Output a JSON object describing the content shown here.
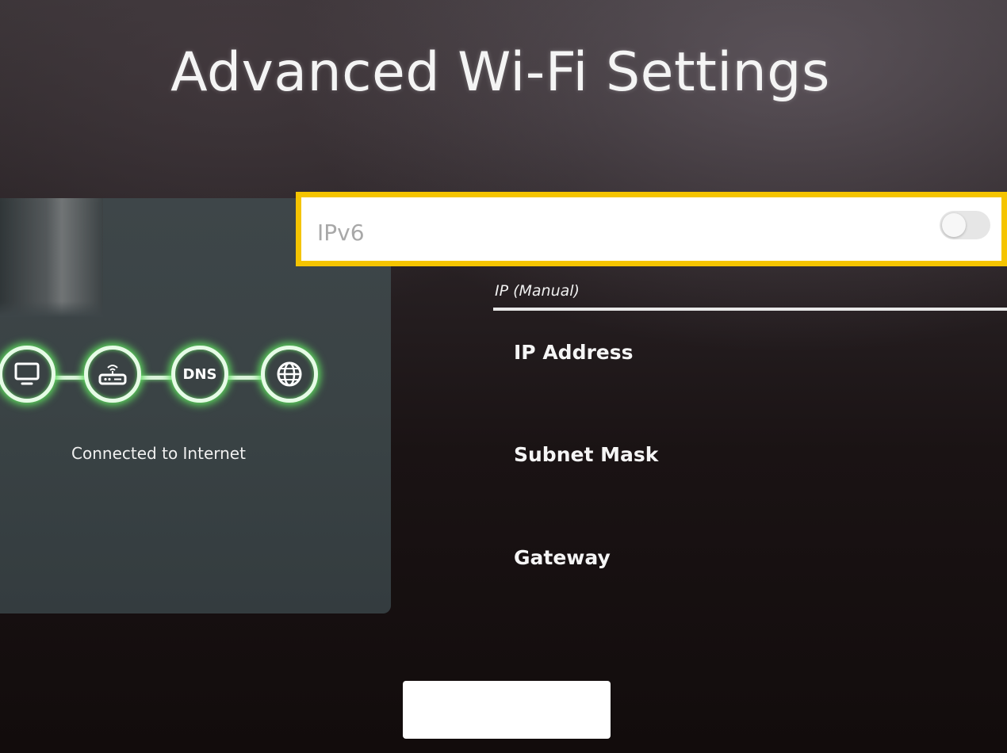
{
  "page": {
    "title": "Advanced Wi-Fi Settings"
  },
  "preview": {
    "status_text": "Connected to Internet",
    "nodes": [
      {
        "icon": "tv-icon",
        "label": ""
      },
      {
        "icon": "router-icon",
        "label": ""
      },
      {
        "icon": "dns-node",
        "label": "DNS"
      },
      {
        "icon": "globe-icon",
        "label": ""
      }
    ]
  },
  "ipv6": {
    "label": "IPv6",
    "enabled": false
  },
  "ip_settings": {
    "mode_label": "IP (Manual)",
    "fields": [
      {
        "label": "IP Address",
        "value": ""
      },
      {
        "label": "Subnet Mask",
        "value": ""
      },
      {
        "label": "Gateway",
        "value": ""
      }
    ]
  },
  "bottom_button": {
    "label": ""
  },
  "colors": {
    "focus_border": "#f5c400",
    "chain_glow": "#5fe05f",
    "panel_bg": "#3e4649"
  }
}
